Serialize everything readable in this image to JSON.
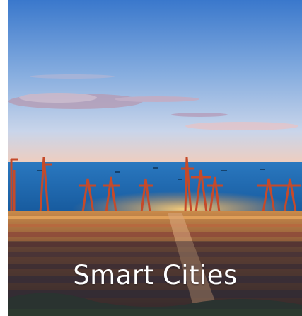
{
  "tile": {
    "caption": "Smart Cities",
    "image_subject": "container-port-at-dusk"
  },
  "colors": {
    "sky_top": "#3f7fd0",
    "sky_mid": "#8fb4e6",
    "horizon": "#f2c9b5",
    "sea": "#1f6fb8",
    "dock_light": "#ffb347",
    "caption_text": "#ffffff"
  }
}
